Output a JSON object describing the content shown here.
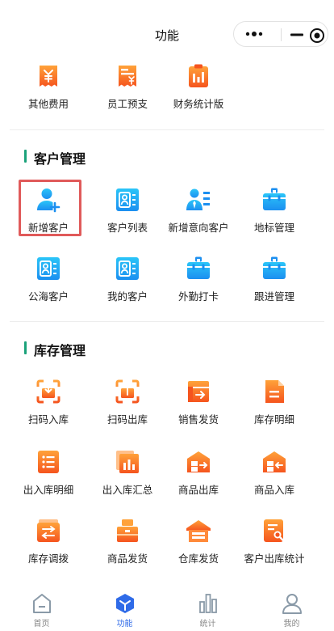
{
  "nav": {
    "title": "功能"
  },
  "top_row": [
    {
      "label": "其他费用",
      "icon": "yuan-receipt-icon"
    },
    {
      "label": "员工预支",
      "icon": "yuan-ticket-icon"
    },
    {
      "label": "财务统计版",
      "icon": "bar-chart-clipboard-icon"
    }
  ],
  "customer_section": {
    "title": "客户管理",
    "items": [
      {
        "label": "新增客户",
        "icon": "add-user-icon"
      },
      {
        "label": "客户列表",
        "icon": "contact-card-icon"
      },
      {
        "label": "新增意向客户",
        "icon": "person-list-icon"
      },
      {
        "label": "地标管理",
        "icon": "briefcase-icon"
      },
      {
        "label": "公海客户",
        "icon": "contact-card-icon"
      },
      {
        "label": "我的客户",
        "icon": "contact-card-icon"
      },
      {
        "label": "外勤打卡",
        "icon": "briefcase-icon"
      },
      {
        "label": "跟进管理",
        "icon": "briefcase-icon"
      }
    ]
  },
  "inventory_section": {
    "title": "库存管理",
    "items": [
      {
        "label": "扫码入库",
        "icon": "scan-in-icon"
      },
      {
        "label": "扫码出库",
        "icon": "scan-out-icon"
      },
      {
        "label": "销售发货",
        "icon": "box-export-icon"
      },
      {
        "label": "库存明细",
        "icon": "document-icon"
      },
      {
        "label": "出入库明细",
        "icon": "list-icon"
      },
      {
        "label": "出入库汇总",
        "icon": "stacked-chart-icon"
      },
      {
        "label": "商品出库",
        "icon": "warehouse-out-icon"
      },
      {
        "label": "商品入库",
        "icon": "warehouse-in-icon"
      },
      {
        "label": "库存调拨",
        "icon": "transfer-icon"
      },
      {
        "label": "商品发货",
        "icon": "package-icon"
      },
      {
        "label": "仓库发货",
        "icon": "warehouse-icon"
      },
      {
        "label": "客户出库统计",
        "icon": "report-search-icon"
      }
    ]
  },
  "tabbar": [
    {
      "label": "首页",
      "icon": "home-icon",
      "active": false
    },
    {
      "label": "功能",
      "icon": "cube-icon",
      "active": true
    },
    {
      "label": "统计",
      "icon": "bar-chart-icon",
      "active": false
    },
    {
      "label": "我的",
      "icon": "user-icon",
      "active": false
    }
  ],
  "colors": {
    "orange_light": "#ffa23a",
    "orange_dark": "#f5541e",
    "blue_light": "#2bc5f8",
    "blue_dark": "#1c8ff0",
    "section_bar": "#1aa27a",
    "highlight": "#e05a5a",
    "tab_active": "#2f6be8",
    "tab_inactive": "#888888"
  }
}
